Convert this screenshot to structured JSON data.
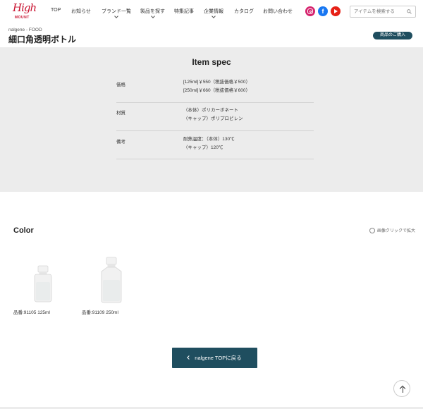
{
  "header": {
    "logo": {
      "script": "High",
      "sub": "MOUNT"
    },
    "nav": [
      {
        "label": "TOP",
        "has_dropdown": false
      },
      {
        "label": "お知らせ",
        "has_dropdown": false
      },
      {
        "label": "ブランド一覧",
        "has_dropdown": true
      },
      {
        "label": "製品を探す",
        "has_dropdown": true
      },
      {
        "label": "特集記事",
        "has_dropdown": false
      },
      {
        "label": "企業情報",
        "has_dropdown": true
      },
      {
        "label": "カタログ",
        "has_dropdown": false
      },
      {
        "label": "お問い合わせ",
        "has_dropdown": false
      }
    ],
    "social": [
      {
        "name": "instagram-icon",
        "color": "#d6246e"
      },
      {
        "name": "facebook-icon",
        "color": "#1877f2",
        "glyph": "f"
      },
      {
        "name": "youtube-icon",
        "color": "#e62117"
      }
    ],
    "search": {
      "placeholder": "アイテムを検索する"
    }
  },
  "breadcrumb": "nalgene - FOOD",
  "page_title": "細口角透明ボトル",
  "buy_button": "商品のご購入",
  "spec": {
    "title": "Item spec",
    "rows": [
      {
        "label": "価格",
        "values": [
          "[125ml]￥550（税抜価格￥500）",
          "[250ml]￥660（税抜価格￥600）"
        ]
      },
      {
        "label": "材質",
        "values": [
          "（本体）ポリカーボネート",
          "（キャップ）ポリプロピレン"
        ]
      },
      {
        "label": "備考",
        "values": [
          "耐熱温度：（本体）130℃",
          "（キャップ）120℃"
        ]
      }
    ]
  },
  "color_section": {
    "title": "Color",
    "zoom_hint": "画像クリックで拡大",
    "products": [
      {
        "label": "品番:91105 125ml"
      },
      {
        "label": "品番:91109 250ml"
      }
    ]
  },
  "back_button": "nalgene TOPに戻る",
  "colors": {
    "accent": "#1f4e5f",
    "brand_red": "#c8102e",
    "spec_bg": "#ececec"
  }
}
